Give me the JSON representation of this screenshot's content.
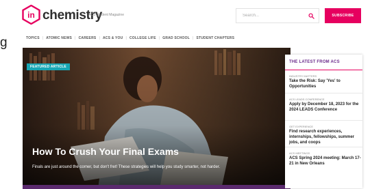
{
  "brand": {
    "logo_text": "chemistry",
    "logo_mark_text": "in",
    "tagline": "ACS Student Magazine",
    "accent": "#e6005f",
    "purple": "#6a2a8a"
  },
  "search": {
    "placeholder": "Search...",
    "icon": "search-icon"
  },
  "subscribe_label": "SUBSCRIBE",
  "left_clip_text": "g",
  "nav": {
    "items": [
      "TOPICS",
      "ATOMIC NEWS",
      "CAREERS",
      "ACS & YOU",
      "COLLEGE LIFE",
      "GRAD SCHOOL",
      "STUDENT CHAPTERS"
    ],
    "separator": "|"
  },
  "hero": {
    "badge": "FEATURED ARTICLE",
    "title": "How To Crush Your Final Exams",
    "subtitle": "Finals are just around the corner, but don't fret! These strategies will help you study smarter, not harder."
  },
  "sidebar": {
    "title": "THE LATEST FROM ACS",
    "stories": [
      {
        "category": "INDUSTRY MATTERS",
        "headline": "Take the Risk: Say 'Yes' to Opportunities"
      },
      {
        "category": "ACS LEADS CONFERENCE",
        "headline": "Apply by December 18, 2023 for the 2024 LEADS Conference"
      },
      {
        "category": "GET EXPERIENCE",
        "headline": "Find research experiences, internships, fellowships, summer jobs, and coops"
      },
      {
        "category": "ACS MEETINGS",
        "headline": "ACS Spring 2024 meeting: March 17-21 in New Orleans"
      }
    ]
  }
}
